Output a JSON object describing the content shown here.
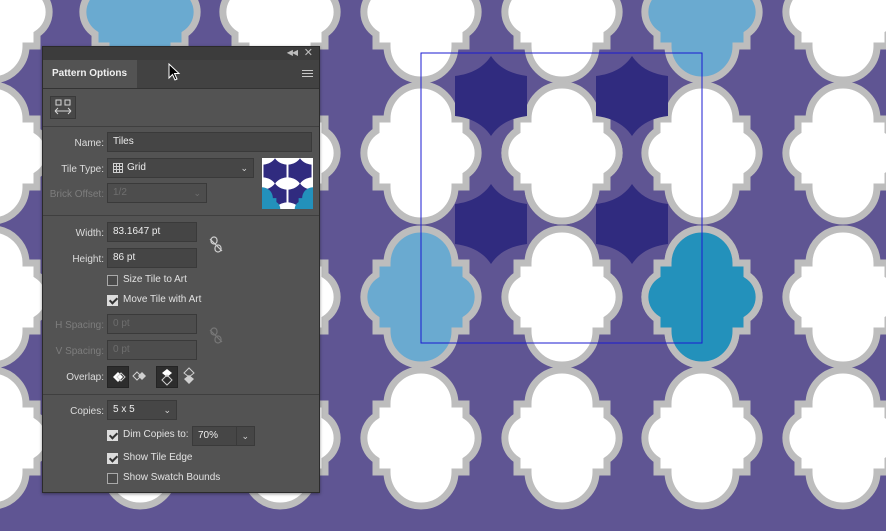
{
  "panel": {
    "title": "Pattern Options",
    "name_label": "Name:",
    "name_value": "Tiles",
    "tile_type_label": "Tile Type:",
    "tile_type_value": "Grid",
    "brick_offset_label": "Brick Offset:",
    "brick_offset_value": "1/2",
    "width_label": "Width:",
    "width_value": "83.1647 pt",
    "height_label": "Height:",
    "height_value": "86 pt",
    "size_tile_to_art": {
      "label": "Size Tile to Art",
      "checked": false
    },
    "move_tile_with_art": {
      "label": "Move Tile with Art",
      "checked": true
    },
    "h_spacing_label": "H Spacing:",
    "h_spacing_value": "0 pt",
    "v_spacing_label": "V Spacing:",
    "v_spacing_value": "0 pt",
    "overlap_label": "Overlap:",
    "copies_label": "Copies:",
    "copies_value": "5 x 5",
    "dim_copies": {
      "label": "Dim Copies to:",
      "checked": true,
      "value": "70%"
    },
    "show_tile_edge": {
      "label": "Show Tile Edge",
      "checked": true
    },
    "show_swatch_bounds": {
      "label": "Show Swatch Bounds",
      "checked": false
    }
  },
  "colors": {
    "background": "#5f5593",
    "outline": "#bdbdbd",
    "dim_white": "#ffffff",
    "dim_blue": "#6aaad0",
    "navy": "#302b7f",
    "teal": "#2391bb",
    "tile_edge": "#1b1bd0",
    "panel_bg": "#535353"
  },
  "icons": [
    "collapse-icon",
    "close-icon",
    "panel-menu-icon",
    "fit-tile-icon",
    "grid-icon",
    "link-icon",
    "overlap-icons"
  ]
}
